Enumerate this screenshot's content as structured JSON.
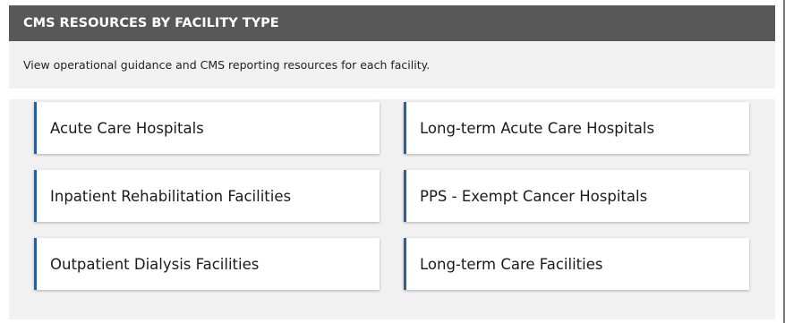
{
  "section": {
    "title": "CMS RESOURCES BY FACILITY TYPE",
    "description": "View operational guidance and CMS reporting resources for each facility."
  },
  "facilities": [
    {
      "label": "Acute Care Hospitals"
    },
    {
      "label": "Long-term Acute Care Hospitals"
    },
    {
      "label": "Inpatient Rehabilitation Facilities"
    },
    {
      "label": "PPS - Exempt Cancer Hospitals"
    },
    {
      "label": "Outpatient Dialysis Facilities"
    },
    {
      "label": "Long-term Care Facilities"
    }
  ],
  "colors": {
    "header_bg": "#585858",
    "panel_bg": "#f1f1f1",
    "card_accent": "#2a5f9e"
  }
}
